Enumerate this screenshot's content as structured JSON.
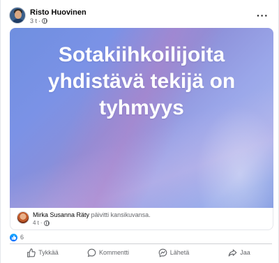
{
  "post": {
    "author": "Risto Huovinen",
    "time": "3 t",
    "text": "Sotakiihkoilijoita yhdistävä tekijä on tyhmyys",
    "more_icon": "more-horizontal-icon"
  },
  "shared": {
    "name": "Mirka Susanna Räty",
    "action": "päivitti kansikuvansa.",
    "time": "4 t"
  },
  "reactions": {
    "count": "6",
    "type": "like"
  },
  "actions": {
    "like": "Tykkää",
    "comment": "Kommentti",
    "send": "Lähetä",
    "share": "Jaa"
  },
  "colors": {
    "accent": "#0866ff",
    "muted_text": "#65676b",
    "background_gradient_start": "#6f8fe0",
    "background_gradient_end": "#a6b7ef"
  }
}
